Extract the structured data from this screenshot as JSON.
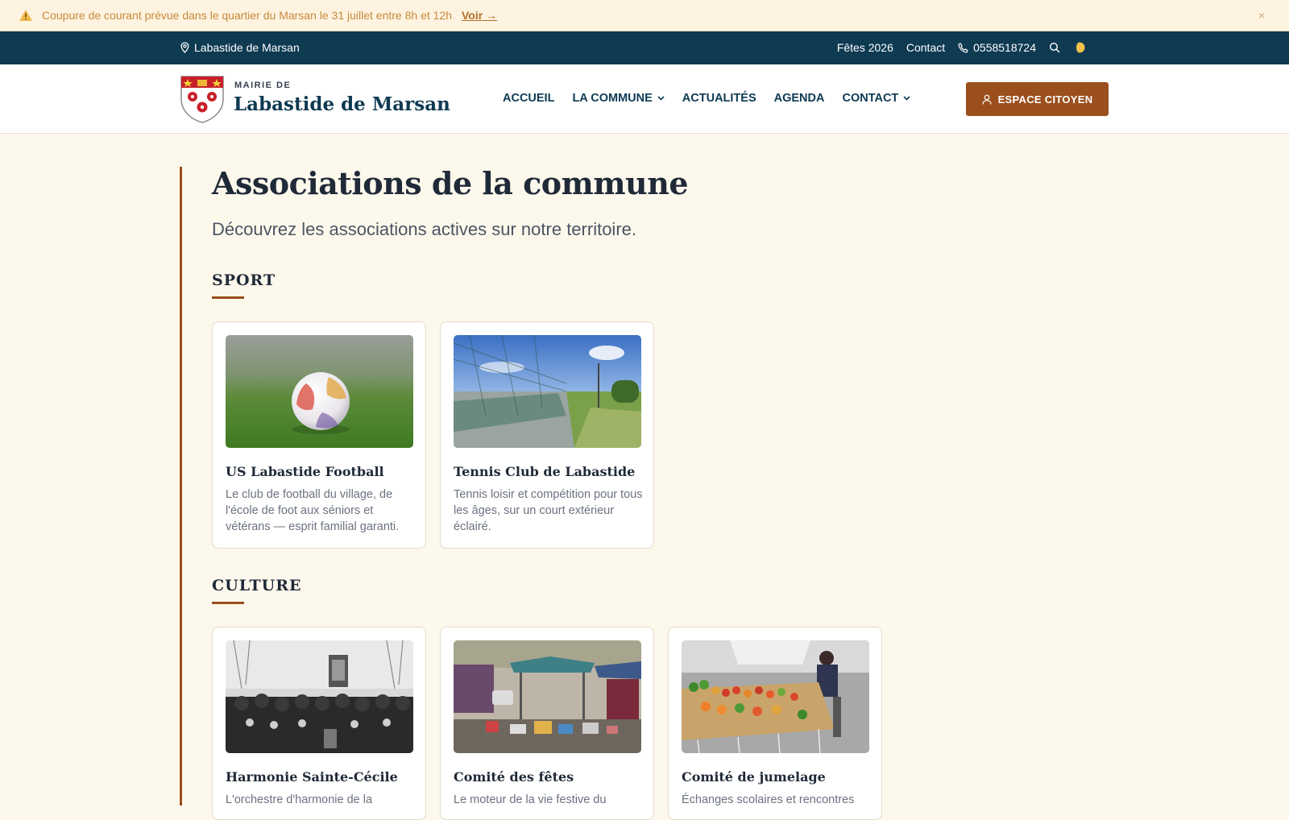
{
  "alert": {
    "message": "Coupure de courant prévue dans le quartier du Marsan le 31 juillet entre 8h et 12h",
    "link": "Voir →",
    "close": "×"
  },
  "topbar": {
    "location": "Labastide de Marsan",
    "links": [
      "Fêtes 2026",
      "Contact"
    ],
    "phone": "0558518724"
  },
  "header": {
    "brand_sup": "MAIRIE DE",
    "brand_name": "Labastide de Marsan",
    "nav": [
      "ACCUEIL",
      "LA COMMUNE",
      "ACTUALITÉS",
      "AGENDA",
      "CONTACT"
    ],
    "cta": "ESPACE CITOYEN"
  },
  "page": {
    "title": "Associations de la commune",
    "subtitle": "Découvrez les associations actives sur notre territoire."
  },
  "sections": [
    {
      "title": "SPORT",
      "cards": [
        {
          "name": "US Labastide Football",
          "desc": "Le club de football du village, de l'école de foot aux séniors et vétérans — esprit familial garanti."
        },
        {
          "name": "Tennis Club de Labastide",
          "desc": "Tennis loisir et compétition pour tous les âges, sur un court extérieur éclairé."
        }
      ]
    },
    {
      "title": "CULTURE",
      "cards": [
        {
          "name": "Harmonie Sainte-Cécile",
          "desc": "L'orchestre d'harmonie de la"
        },
        {
          "name": "Comité des fêtes",
          "desc": "Le moteur de la vie festive du"
        },
        {
          "name": "Comité de jumelage",
          "desc": "Échanges scolaires et rencontres"
        }
      ]
    }
  ],
  "colors": {
    "primary": "#0e3a52",
    "accent": "#9a4f1d",
    "background": "#fdf8ec",
    "alert_bg": "#fdf3e0"
  },
  "icons": [
    "warning-icon",
    "close-icon",
    "location-pin-icon",
    "phone-icon",
    "search-icon",
    "theme-toggle-icon",
    "chevron-down-icon",
    "user-icon"
  ]
}
